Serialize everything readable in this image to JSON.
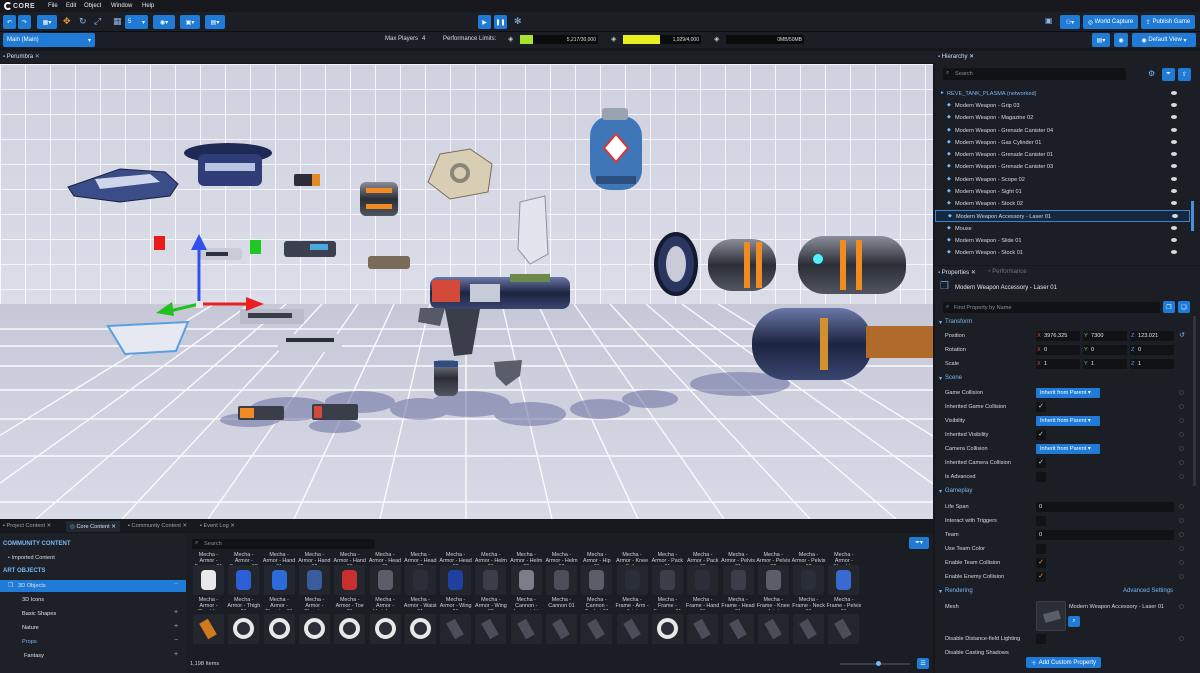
{
  "menu": {
    "logo": "CORE",
    "items": [
      "File",
      "Edit",
      "Object",
      "Window",
      "Help"
    ]
  },
  "toolbar": {
    "grid_value": "5",
    "world_capture": "World Capture",
    "publish_game": "Publish Game",
    "level": "Main (Main)",
    "max_players_label": "Max Players",
    "max_players": "4",
    "perf_label": "Performance Limits:",
    "perf": [
      {
        "value": "5,217/30,000",
        "fill": 0.17,
        "color": "#a6e22e"
      },
      {
        "value": "1,929/4,000",
        "fill": 0.48,
        "color": "#e8ef1f"
      },
      {
        "value": "0MB/50MB",
        "fill": 0.0,
        "color": "#a6e22e"
      }
    ],
    "default_view": "Default View"
  },
  "viewport": {
    "tab": "Perumbra"
  },
  "hierarchy": {
    "tab": "Hierarchy",
    "search_placeholder": "Search",
    "root": "REVE_TANK_PLASMA (networked)",
    "items": [
      "Modern Weapon - Grip 03",
      "Modern Weapon - Magazine 02",
      "Modern Weapon - Grenade Canister 04",
      "Modern Weapon - Gas Cylinder 01",
      "Modern Weapon - Grenade Canister 01",
      "Modern Weapon - Grenade Canister 03",
      "Modern Weapon - Scope 02",
      "Modern Weapon - Sight 01",
      "Modern Weapon - Stock 02",
      "Modern Weapon Accessory - Laser 01",
      "Mouse",
      "Modern Weapon - Slide 01",
      "Modern Weapon - Stock 01"
    ],
    "selected_index": 9
  },
  "properties": {
    "tab": "Properties",
    "tab2": "Performance",
    "object_name": "Modern Weapon Accessory - Laser 01",
    "search_placeholder": "Find Property by Name",
    "transform_label": "Transform",
    "position_label": "Position",
    "position": [
      "3976.325",
      "7300",
      "123.021"
    ],
    "rotation_label": "Rotation",
    "rotation": [
      "0",
      "0",
      "0"
    ],
    "scale_label": "Scale",
    "scale": [
      "1",
      "1",
      "1"
    ],
    "axes": [
      "X",
      "Y",
      "Z"
    ],
    "scene_label": "Scene",
    "game_collision_label": "Game Collision",
    "game_collision": "Inherit from Parent",
    "inherited_game_collision_label": "Inherited Game Collision",
    "visibility_label": "Visibility",
    "visibility": "Inherit from Parent",
    "inherited_visibility_label": "Inherited Visibility",
    "camera_collision_label": "Camera Collision",
    "camera_collision": "Inherit from Parent",
    "inherited_camera_collision_label": "Inherited Camera Collision",
    "is_advanced_label": "Is Advanced",
    "gameplay_label": "Gameplay",
    "life_span_label": "Life Span",
    "life_span": "0",
    "interact_label": "Interact with Triggers",
    "team_label": "Team",
    "team": "0",
    "use_team_color_label": "Use Team Color",
    "enable_team_collision_label": "Enable Team Collision",
    "enable_enemy_collision_label": "Enable Enemy Collision",
    "rendering_label": "Rendering",
    "advanced_settings": "Advanced Settings",
    "mesh_label": "Mesh",
    "mesh_value": "Modern Weapon Accessory - Laser 01",
    "disable_lighting_label": "Disable Distance-field Lighting",
    "disable_shadows_label": "Disable Casting Shadows",
    "add_custom_property": "Add Custom Property"
  },
  "bottom": {
    "tabs": [
      "Project Content",
      "Core Content",
      "Community Content",
      "Event Log"
    ],
    "active_tab": 1,
    "community_heading": "COMMUNITY CONTENT",
    "imported": "Imported Content",
    "art_heading": "ART OBJECTS",
    "tree": [
      {
        "label": "3D Objects",
        "selected": true,
        "sign": "−"
      },
      {
        "label": "3D Icons",
        "selected": false,
        "sign": ""
      },
      {
        "label": "Basic Shapes",
        "selected": false,
        "sign": "+"
      },
      {
        "label": "Nature",
        "selected": false,
        "sign": "+"
      },
      {
        "label": "Props",
        "selected": false,
        "sign": "−"
      },
      {
        "label": "Fantasy",
        "selected": false,
        "sign": "+"
      }
    ],
    "search_placeholder": "Search",
    "item_count": "1,198 Items",
    "row1_top": [
      "Mecha - Armor - Forearm 01",
      "Mecha - Armor - Forearm 02",
      "Mecha - Armor - Hand 01",
      "Mecha - Armor - Hand 02",
      "Mecha - Armor - Hand 03",
      "Mecha - Armor - Head 01",
      "Mecha - Armor - Head 02",
      "Mecha - Armor - Head 03",
      "Mecha - Armor - Helm 01",
      "Mecha - Armor - Helm 02",
      "Mecha - Armor - Helm 03",
      "Mecha - Armor - Hip 01",
      "Mecha - Armor - Knee Spike",
      "Mecha - Armor - Pack 01",
      "Mecha - Armor - Pack 02",
      "Mecha - Armor - Pelvis 01",
      "Mecha - Armor - Pelvis 02",
      "Mecha - Armor - Pelvis 03",
      "Mecha - Armor - Shoulder"
    ],
    "row1_bottom": [
      "Mecha - Armor - Shoulder",
      "Mecha - Armor - Thigh 01",
      "Mecha - Armor - Thruster 01",
      "Mecha - Armor - Thruster",
      "Mecha - Armor - Toe 01",
      "Mecha - Armor - Vertebrae",
      "Mecha - Armor - Waist 01",
      "Mecha - Armor - Wing 01",
      "Mecha - Armor - Wing 02",
      "Mecha - Cannon - Lasersight",
      "Mecha - Cannon 01",
      "Mecha - Cannon - Socket 01",
      "Mecha - Frame - Arm - Joint",
      "Mecha - Frame - Forearm 01",
      "Mecha - Frame - Hand 01",
      "Mecha - Frame - Head 01",
      "Mecha - Frame - Knee Joint",
      "Mecha - Frame - Neck 01",
      "Mecha - Frame - Pelvis 01"
    ]
  }
}
